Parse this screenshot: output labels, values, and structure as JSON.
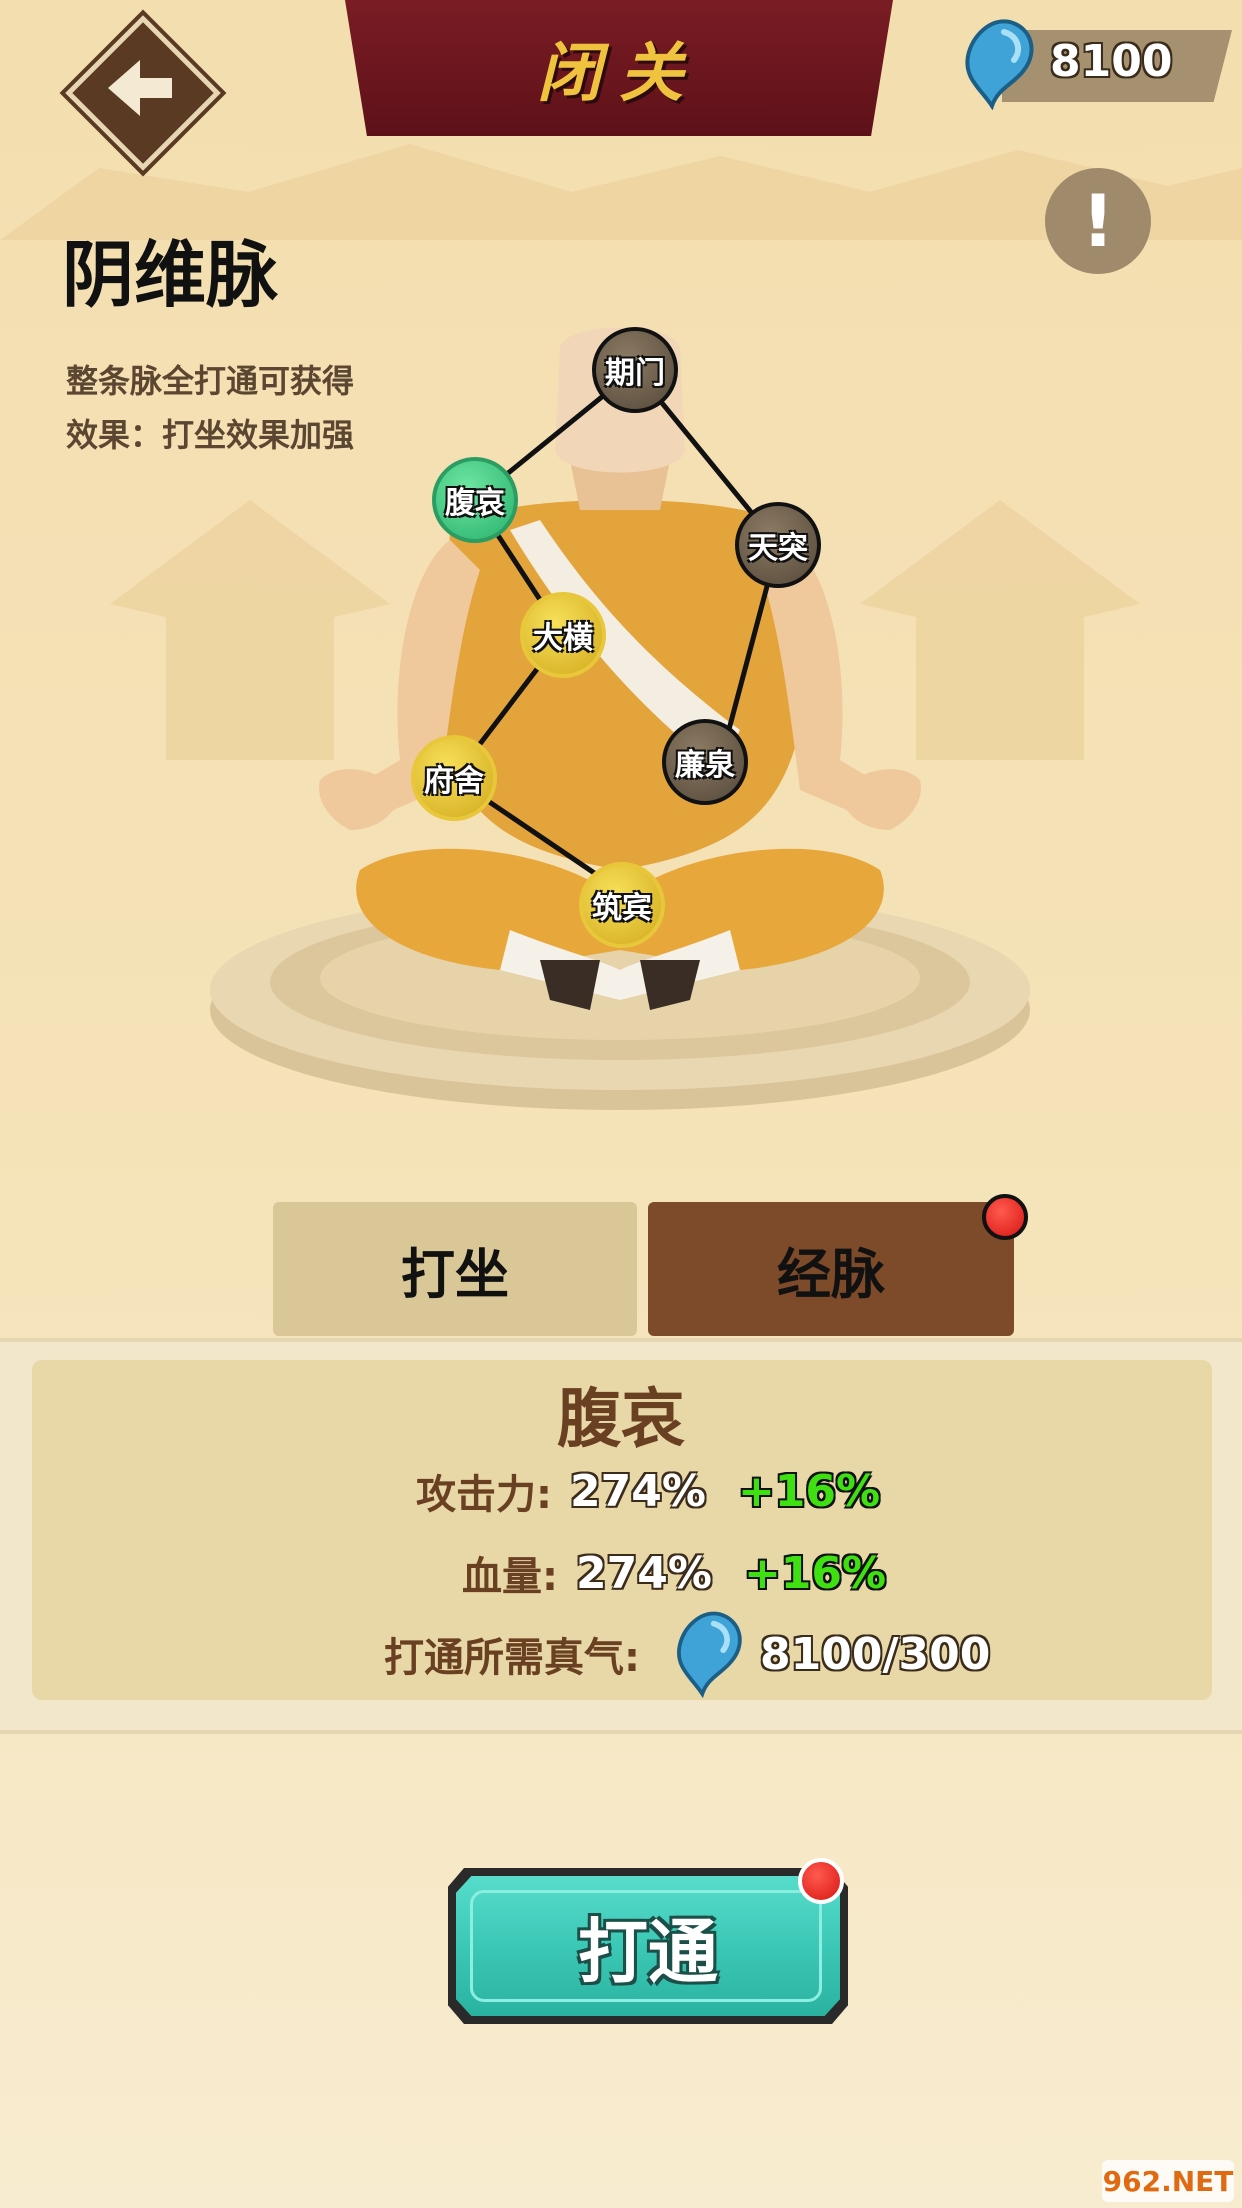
{
  "header": {
    "title": "闭关",
    "currency": {
      "icon": "qi-droplet-icon",
      "value": "8100"
    }
  },
  "meridian": {
    "name": "阴维脉",
    "description_line1": "整条脉全打通可获得",
    "description_line2": "效果：打坐效果加强"
  },
  "acupoints": [
    {
      "label": "期门",
      "state": "locked"
    },
    {
      "label": "腹哀",
      "state": "selected"
    },
    {
      "label": "天突",
      "state": "locked"
    },
    {
      "label": "大横",
      "state": "open"
    },
    {
      "label": "廉泉",
      "state": "locked"
    },
    {
      "label": "府舍",
      "state": "open"
    },
    {
      "label": "筑宾",
      "state": "open"
    }
  ],
  "tabs": [
    {
      "label": "打坐",
      "active": false
    },
    {
      "label": "经脉",
      "active": true,
      "notification": true
    }
  ],
  "detail": {
    "point_name": "腹哀",
    "attack_label": "攻击力:",
    "attack_value": "274%",
    "attack_bonus": "+16%",
    "hp_label": "血量:",
    "hp_value": "274%",
    "hp_bonus": "+16%",
    "cost_label": "打通所需真气:",
    "cost_value": "8100/300"
  },
  "action": {
    "label": "打通",
    "notification": true
  },
  "watermark": "962.NET",
  "colors": {
    "banner": "#6b1520",
    "title_gold": "#f0c33f",
    "selected_node": "#2fb86f",
    "open_node": "#e9c433",
    "locked_node": "#6b5c48",
    "bonus_green": "#3fe012",
    "button_teal": "#3cc8b6",
    "tab_active": "#7d4a2a",
    "tab_inactive": "#dac797"
  }
}
